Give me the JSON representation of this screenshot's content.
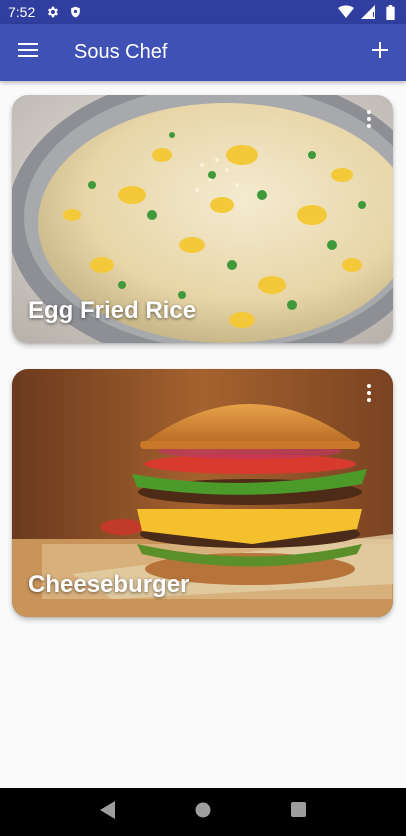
{
  "status_bar": {
    "time": "7:52",
    "icons_left": [
      "settings-icon",
      "shield-icon"
    ],
    "icons_right": [
      "wifi-icon",
      "signal-icon",
      "battery-icon"
    ]
  },
  "app_bar": {
    "title": "Sous Chef",
    "menu_icon": "hamburger-menu-icon",
    "action_icon": "add-icon",
    "background_color": "#3f51b5",
    "status_bar_color": "#303f9f"
  },
  "recipes": [
    {
      "title": "Egg Fried Rice",
      "image": "egg-fried-rice-photo",
      "menu_icon": "more-vert-icon"
    },
    {
      "title": "Cheeseburger",
      "image": "cheeseburger-photo",
      "menu_icon": "more-vert-icon"
    }
  ],
  "nav_bar": {
    "icons": [
      "back-icon",
      "home-icon",
      "recents-icon"
    ]
  }
}
